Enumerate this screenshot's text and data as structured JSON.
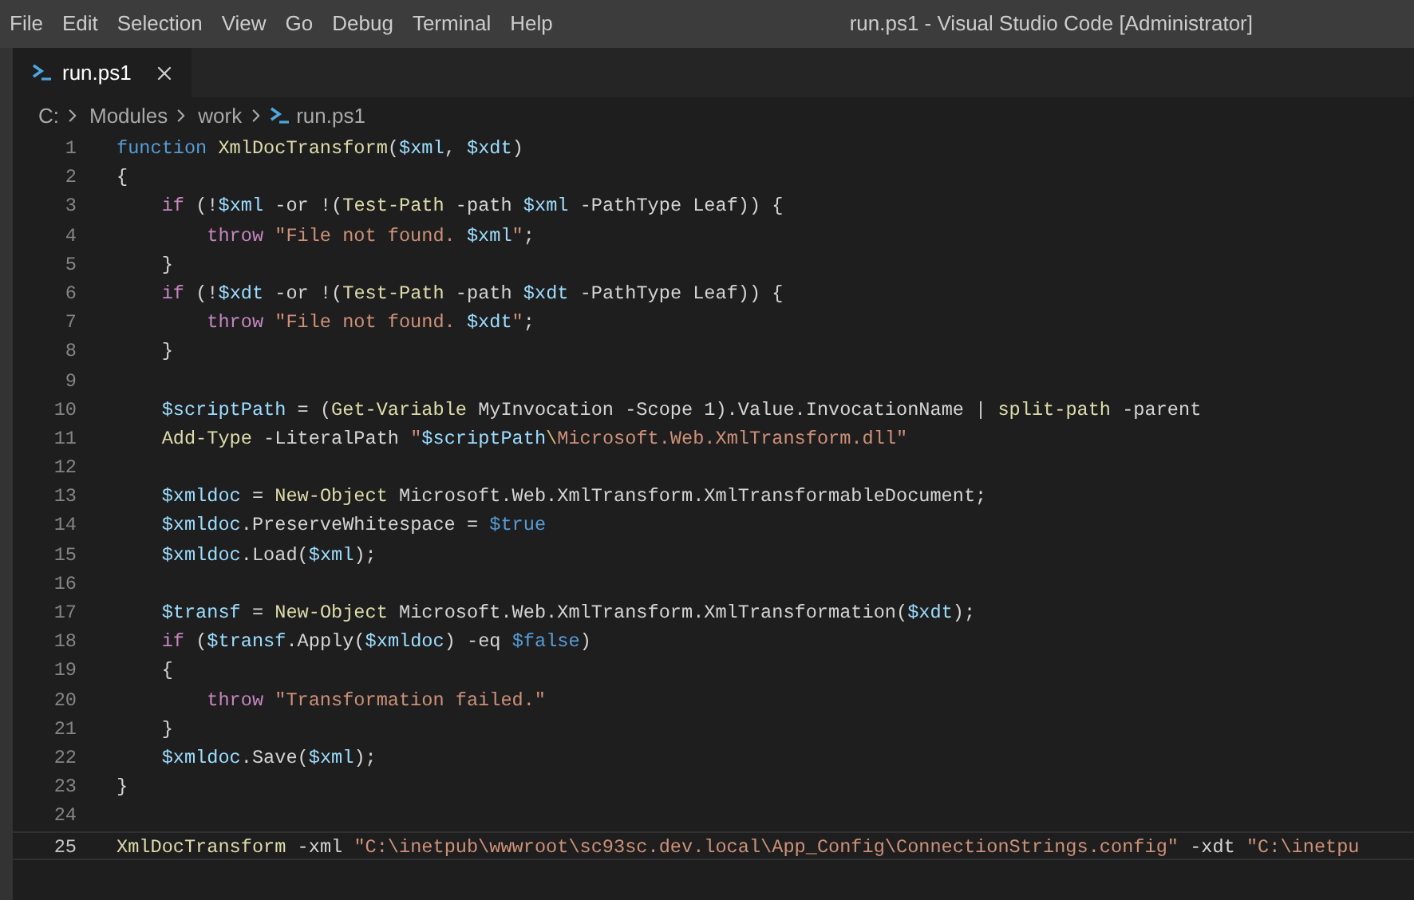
{
  "menu": [
    "File",
    "Edit",
    "Selection",
    "View",
    "Go",
    "Debug",
    "Terminal",
    "Help"
  ],
  "window": {
    "title": "run.ps1 - Visual Studio Code [Administrator]"
  },
  "tabs": [
    {
      "label": "run.ps1",
      "selected": true
    }
  ],
  "breadcrumb": [
    "C:",
    "Modules",
    "work",
    "run.ps1"
  ],
  "lines": [
    {
      "number": "1",
      "current": false,
      "tokens": [
        {
          "kind": "keyword",
          "text": "function"
        },
        {
          "kind": "function",
          "text": " XmlDocTransform"
        },
        {
          "kind": "plain",
          "text": "("
        },
        {
          "kind": "variable",
          "text": "$xml"
        },
        {
          "kind": "plain",
          "text": ", "
        },
        {
          "kind": "variable",
          "text": "$xdt"
        },
        {
          "kind": "plain",
          "text": ")"
        }
      ]
    },
    {
      "number": "2",
      "current": false,
      "tokens": [
        {
          "kind": "plain",
          "text": "{"
        }
      ]
    },
    {
      "number": "3",
      "current": false,
      "tokens": [
        {
          "kind": "control",
          "text": "    if"
        },
        {
          "kind": "plain",
          "text": " (!"
        },
        {
          "kind": "variable",
          "text": "$xml"
        },
        {
          "kind": "plain",
          "text": " -or !("
        },
        {
          "kind": "function",
          "text": "Test-Path"
        },
        {
          "kind": "plain",
          "text": " -path "
        },
        {
          "kind": "variable",
          "text": "$xml"
        },
        {
          "kind": "plain",
          "text": " -PathType Leaf)) {"
        }
      ]
    },
    {
      "number": "4",
      "current": false,
      "tokens": [
        {
          "kind": "control",
          "text": "        throw"
        },
        {
          "kind": "string",
          "text": " \"File not found. "
        },
        {
          "kind": "variable",
          "text": "$xml"
        },
        {
          "kind": "string",
          "text": "\""
        },
        {
          "kind": "plain",
          "text": ";"
        }
      ]
    },
    {
      "number": "5",
      "current": false,
      "tokens": [
        {
          "kind": "plain",
          "text": "    }"
        }
      ]
    },
    {
      "number": "6",
      "current": false,
      "tokens": [
        {
          "kind": "control",
          "text": "    if"
        },
        {
          "kind": "plain",
          "text": " (!"
        },
        {
          "kind": "variable",
          "text": "$xdt"
        },
        {
          "kind": "plain",
          "text": " -or !("
        },
        {
          "kind": "function",
          "text": "Test-Path"
        },
        {
          "kind": "plain",
          "text": " -path "
        },
        {
          "kind": "variable",
          "text": "$xdt"
        },
        {
          "kind": "plain",
          "text": " -PathType Leaf)) {"
        }
      ]
    },
    {
      "number": "7",
      "current": false,
      "tokens": [
        {
          "kind": "control",
          "text": "        throw"
        },
        {
          "kind": "string",
          "text": " \"File not found. "
        },
        {
          "kind": "variable",
          "text": "$xdt"
        },
        {
          "kind": "string",
          "text": "\""
        },
        {
          "kind": "plain",
          "text": ";"
        }
      ]
    },
    {
      "number": "8",
      "current": false,
      "tokens": [
        {
          "kind": "plain",
          "text": "    }"
        }
      ]
    },
    {
      "number": "9",
      "current": false
    },
    {
      "number": "10",
      "current": false,
      "tokens": [
        {
          "kind": "variable",
          "text": "    $scriptPath"
        },
        {
          "kind": "plain",
          "text": " = ("
        },
        {
          "kind": "function",
          "text": "Get-Variable"
        },
        {
          "kind": "plain",
          "text": " MyInvocation -Scope 1).Value.InvocationName | "
        },
        {
          "kind": "function",
          "text": "split-path"
        },
        {
          "kind": "plain",
          "text": " -parent"
        }
      ]
    },
    {
      "number": "11",
      "current": false,
      "tokens": [
        {
          "kind": "function",
          "text": "    Add-Type"
        },
        {
          "kind": "plain",
          "text": " -LiteralPath "
        },
        {
          "kind": "string",
          "text": "\""
        },
        {
          "kind": "variable",
          "text": "$scriptPath"
        },
        {
          "kind": "escape",
          "text": "\\"
        },
        {
          "kind": "string",
          "text": "Microsoft.Web.XmlTransform.dll\""
        }
      ]
    },
    {
      "number": "12",
      "current": false
    },
    {
      "number": "13",
      "current": false,
      "tokens": [
        {
          "kind": "variable",
          "text": "    $xmldoc"
        },
        {
          "kind": "plain",
          "text": " = "
        },
        {
          "kind": "function",
          "text": "New-Object"
        },
        {
          "kind": "plain",
          "text": " Microsoft.Web.XmlTransform.XmlTransformableDocument;"
        }
      ]
    },
    {
      "number": "14",
      "current": false,
      "tokens": [
        {
          "kind": "variable",
          "text": "    $xmldoc"
        },
        {
          "kind": "plain",
          "text": ".PreserveWhitespace = "
        },
        {
          "kind": "keyword",
          "text": "$true"
        }
      ]
    },
    {
      "number": "15",
      "current": false,
      "tokens": [
        {
          "kind": "variable",
          "text": "    $xmldoc"
        },
        {
          "kind": "plain",
          "text": ".Load("
        },
        {
          "kind": "variable",
          "text": "$xml"
        },
        {
          "kind": "plain",
          "text": ");"
        }
      ]
    },
    {
      "number": "16",
      "current": false
    },
    {
      "number": "17",
      "current": false,
      "tokens": [
        {
          "kind": "variable",
          "text": "    $transf"
        },
        {
          "kind": "plain",
          "text": " = "
        },
        {
          "kind": "function",
          "text": "New-Object"
        },
        {
          "kind": "plain",
          "text": " Microsoft.Web.XmlTransform.XmlTransformation("
        },
        {
          "kind": "variable",
          "text": "$xdt"
        },
        {
          "kind": "plain",
          "text": ");"
        }
      ]
    },
    {
      "number": "18",
      "current": false,
      "tokens": [
        {
          "kind": "control",
          "text": "    if"
        },
        {
          "kind": "plain",
          "text": " ("
        },
        {
          "kind": "variable",
          "text": "$transf"
        },
        {
          "kind": "plain",
          "text": ".Apply("
        },
        {
          "kind": "variable",
          "text": "$xmldoc"
        },
        {
          "kind": "plain",
          "text": ") -eq "
        },
        {
          "kind": "keyword",
          "text": "$false"
        },
        {
          "kind": "plain",
          "text": ")"
        }
      ]
    },
    {
      "number": "19",
      "current": false,
      "tokens": [
        {
          "kind": "plain",
          "text": "    {"
        }
      ]
    },
    {
      "number": "20",
      "current": false,
      "tokens": [
        {
          "kind": "control",
          "text": "        throw"
        },
        {
          "kind": "string",
          "text": " \"Transformation failed.\""
        }
      ]
    },
    {
      "number": "21",
      "current": false,
      "tokens": [
        {
          "kind": "plain",
          "text": "    }"
        }
      ]
    },
    {
      "number": "22",
      "current": false,
      "tokens": [
        {
          "kind": "variable",
          "text": "    $xmldoc"
        },
        {
          "kind": "plain",
          "text": ".Save("
        },
        {
          "kind": "variable",
          "text": "$xml"
        },
        {
          "kind": "plain",
          "text": ");"
        }
      ]
    },
    {
      "number": "23",
      "current": false,
      "tokens": [
        {
          "kind": "plain",
          "text": "}"
        }
      ]
    },
    {
      "number": "24",
      "current": false
    },
    {
      "number": "25",
      "current": true,
      "tokens": [
        {
          "kind": "function",
          "text": "XmlDocTransform"
        },
        {
          "kind": "plain",
          "text": " -xml "
        },
        {
          "kind": "string",
          "text": "\"C:\\inetpub\\wwwroot\\sc93sc.dev.local\\App_Config\\ConnectionStrings.config\""
        },
        {
          "kind": "plain",
          "text": " -xdt "
        },
        {
          "kind": "string",
          "text": "\"C:\\inetpu"
        }
      ]
    }
  ]
}
